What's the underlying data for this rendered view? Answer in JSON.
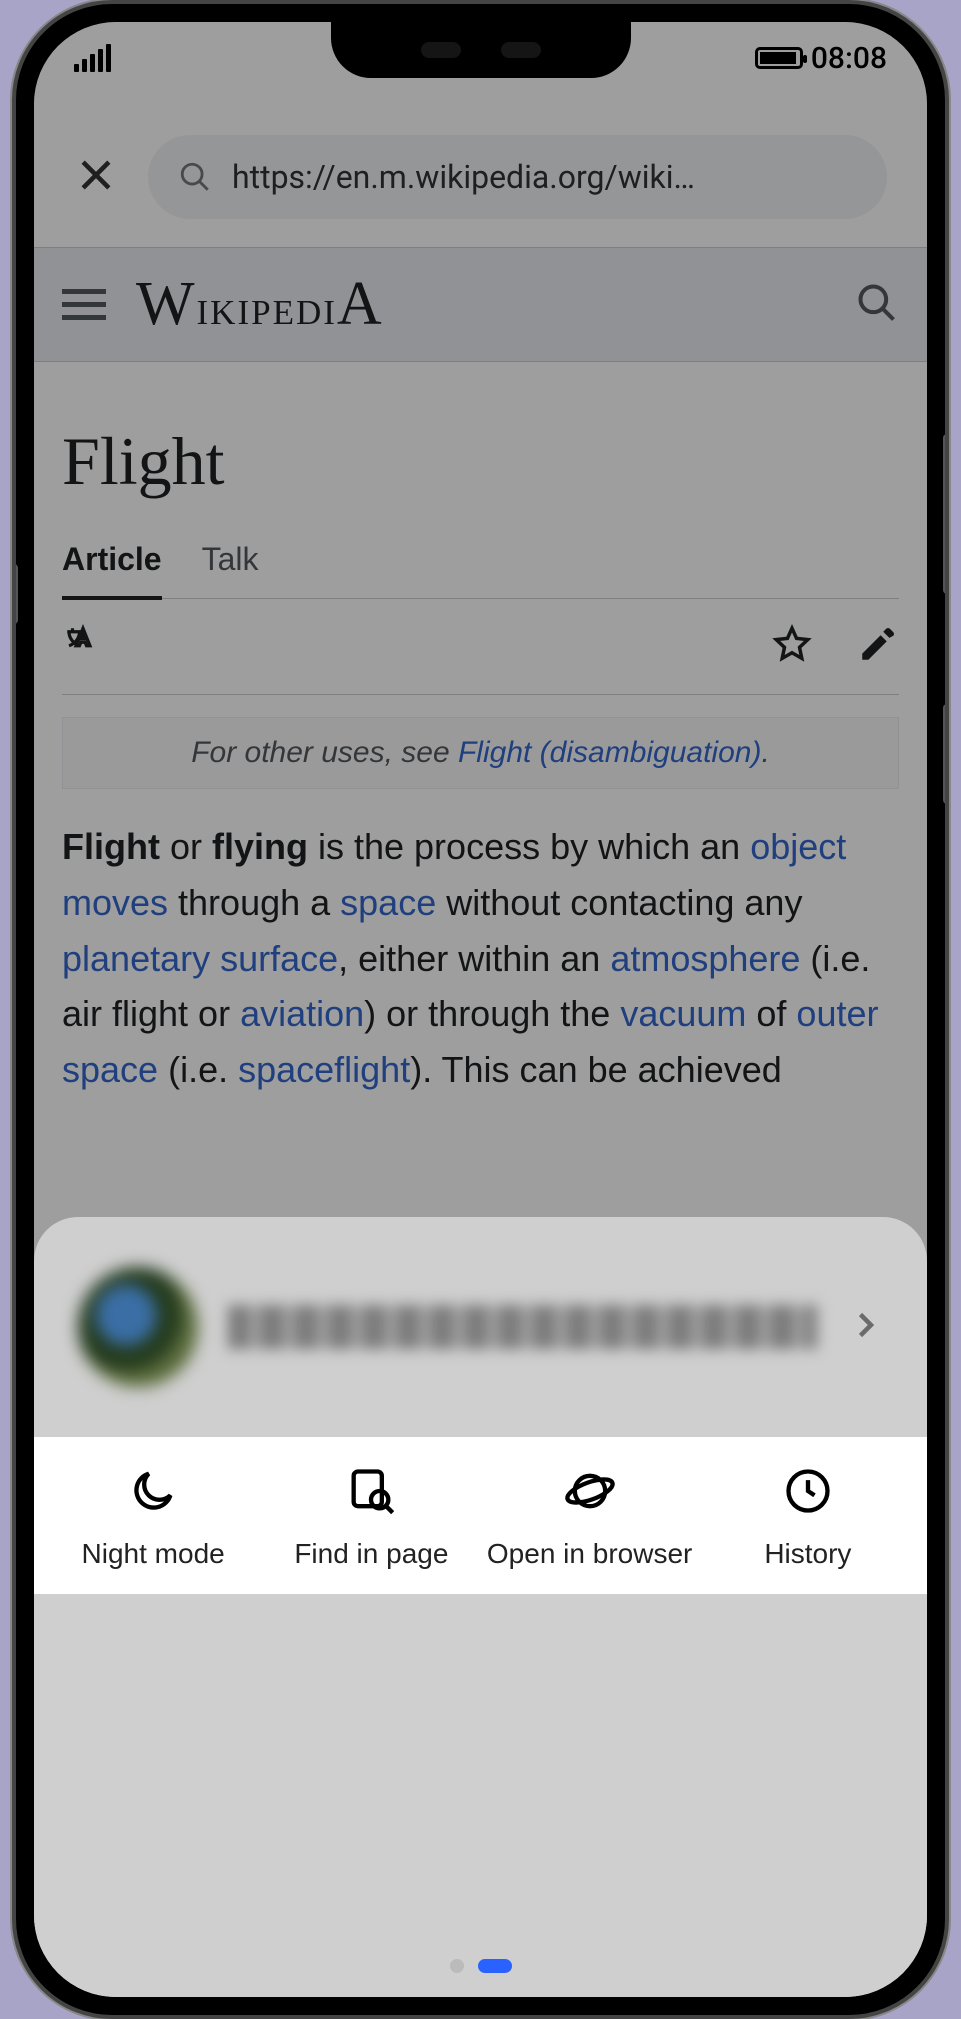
{
  "status": {
    "time": "08:08"
  },
  "browser": {
    "url": "https://en.m.wikipedia.org/wiki…"
  },
  "wiki": {
    "site_name": "Wikipedia",
    "title": "Flight",
    "tabs": {
      "article": "Article",
      "talk": "Talk"
    },
    "hatnote_prefix": "For other uses, see ",
    "hatnote_link": "Flight (disambiguation)",
    "hatnote_suffix": ".",
    "lead": {
      "b1": "Flight",
      "t1": " or ",
      "b2": "flying",
      "t2": " is the process by which an ",
      "l_object": "object",
      "t3": " ",
      "l_moves": "moves",
      "t4": " through a ",
      "l_space": "space",
      "t5": " without contacting any ",
      "l_planetary": "planetary surface",
      "t6": ", either within an ",
      "l_atm": "atmosphere",
      "t7": " (i.e. air flight or ",
      "l_aviation": "aviation",
      "t8": ") or through the ",
      "l_vacuum": "vacuum",
      "t9": " of ",
      "l_outer": "outer space",
      "t10": " (i.e. ",
      "l_spaceflight": "spaceflight",
      "t11": "). This can be achieved"
    }
  },
  "sheet": {
    "actions": {
      "night": "Night mode",
      "find": "Find in page",
      "open": "Open in browser",
      "history": "History"
    }
  }
}
